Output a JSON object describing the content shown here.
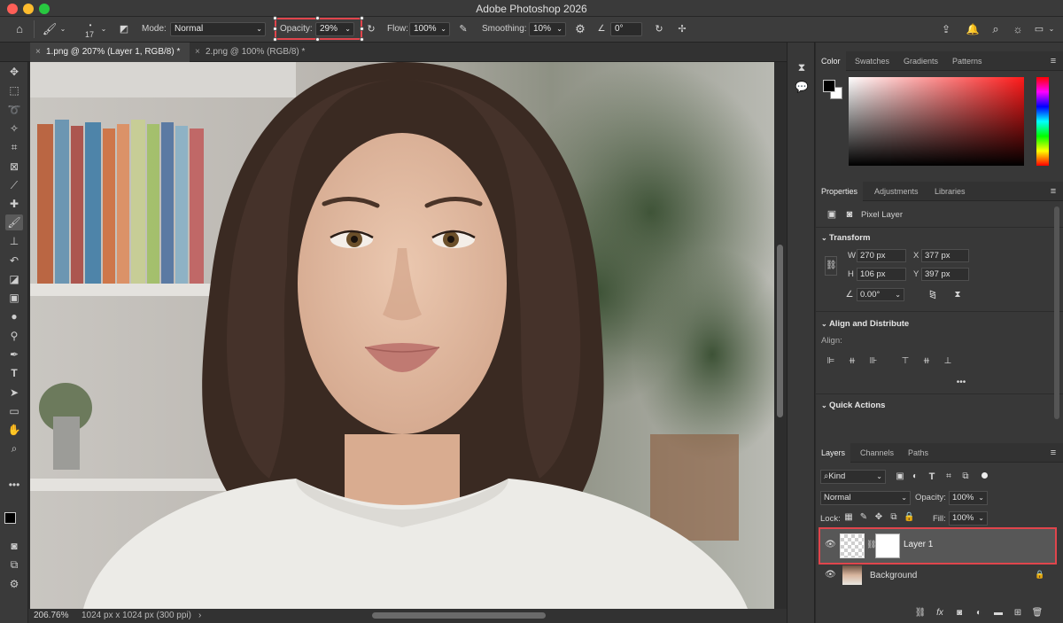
{
  "app": {
    "title": "Adobe Photoshop 2026"
  },
  "options": {
    "brush_size": "17",
    "mode_label": "Mode:",
    "mode_value": "Normal",
    "opacity_label": "Opacity:",
    "opacity_value": "29%",
    "flow_label": "Flow:",
    "flow_value": "100%",
    "smoothing_label": "Smoothing:",
    "smoothing_value": "10%",
    "angle_value": "0°"
  },
  "tabs": [
    {
      "label": "1.png @ 207% (Layer 1, RGB/8) *"
    },
    {
      "label": "2.png @ 100% (RGB/8) *"
    }
  ],
  "status": {
    "zoom": "206.76%",
    "info": "1024 px x 1024 px (300 ppi)"
  },
  "color_panel": {
    "tabs": [
      "Color",
      "Swatches",
      "Gradients",
      "Patterns"
    ]
  },
  "properties": {
    "tabs": [
      "Properties",
      "Adjustments",
      "Libraries"
    ],
    "layer_type": "Pixel Layer",
    "transform_title": "Transform",
    "w_label": "W",
    "w_value": "270 px",
    "h_label": "H",
    "h_value": "106 px",
    "x_label": "X",
    "x_value": "377 px",
    "y_label": "Y",
    "y_value": "397 px",
    "angle_value": "0.00°",
    "align_title": "Align and Distribute",
    "align_label": "Align:",
    "quick_actions": "Quick Actions"
  },
  "layers_panel": {
    "tabs": [
      "Layers",
      "Channels",
      "Paths"
    ],
    "kind": "Kind",
    "blend": "Normal",
    "opacity_label": "Opacity:",
    "opacity_value": "100%",
    "lock_label": "Lock:",
    "fill_label": "Fill:",
    "fill_value": "100%",
    "layers": [
      {
        "name": "Layer 1"
      },
      {
        "name": "Background"
      }
    ]
  },
  "colors": {
    "highlight": "#e0454c",
    "panel": "#383838",
    "canvas_bg": "#2b2b2b"
  }
}
